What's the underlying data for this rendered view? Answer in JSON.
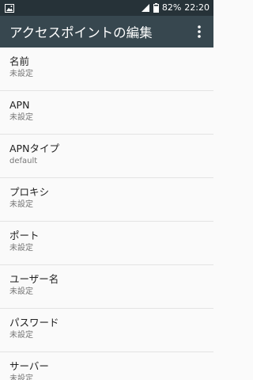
{
  "status_bar": {
    "battery_percent": "82%",
    "time": "22:20",
    "battery_level": 0.82,
    "icons": {
      "left": "image-notification-icon",
      "signal": "signal-icon",
      "battery": "battery-icon"
    }
  },
  "app_bar": {
    "title": "アクセスポイントの編集",
    "menu_icon": "more-vert-icon"
  },
  "settings": [
    {
      "id": "name",
      "title": "名前",
      "summary": "未設定"
    },
    {
      "id": "apn",
      "title": "APN",
      "summary": "未設定"
    },
    {
      "id": "apn-type",
      "title": "APNタイプ",
      "summary": "default"
    },
    {
      "id": "proxy",
      "title": "プロキシ",
      "summary": "未設定"
    },
    {
      "id": "port",
      "title": "ポート",
      "summary": "未設定"
    },
    {
      "id": "username",
      "title": "ユーザー名",
      "summary": "未設定"
    },
    {
      "id": "password",
      "title": "パスワード",
      "summary": "未設定"
    },
    {
      "id": "server",
      "title": "サーバー",
      "summary": "未設定"
    }
  ],
  "colors": {
    "status_bar_bg": "#263238",
    "app_bar_bg": "#37474f",
    "background": "#fafafa",
    "title_text": "#212121",
    "summary_text": "#757575",
    "divider": "#e3e3e3"
  }
}
